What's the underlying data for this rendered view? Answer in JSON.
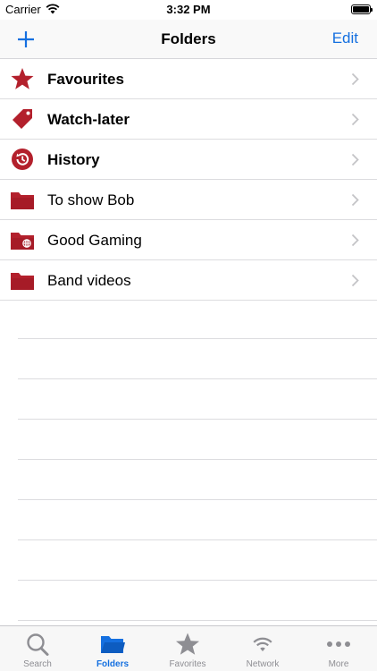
{
  "status_bar": {
    "carrier": "Carrier",
    "time": "3:32 PM"
  },
  "nav": {
    "title": "Folders",
    "edit_label": "Edit"
  },
  "folders": [
    {
      "label": "Favourites",
      "icon": "star-icon"
    },
    {
      "label": "Watch-later",
      "icon": "tag-icon"
    },
    {
      "label": "History",
      "icon": "history-icon"
    },
    {
      "label": "To show Bob",
      "icon": "folder-icon"
    },
    {
      "label": "Good Gaming",
      "icon": "folder-globe-icon"
    },
    {
      "label": "Band videos",
      "icon": "folder-icon"
    }
  ],
  "tabs": [
    {
      "label": "Search",
      "icon": "search-icon"
    },
    {
      "label": "Folders",
      "icon": "folder-icon",
      "active": true
    },
    {
      "label": "Favorites",
      "icon": "star-icon"
    },
    {
      "label": "Network",
      "icon": "wifi-icon"
    },
    {
      "label": "More",
      "icon": "more-icon"
    }
  ],
  "colors": {
    "accent": "#1570e0",
    "icon_red": "#b3202c",
    "tab_inactive": "#8e8e93"
  }
}
